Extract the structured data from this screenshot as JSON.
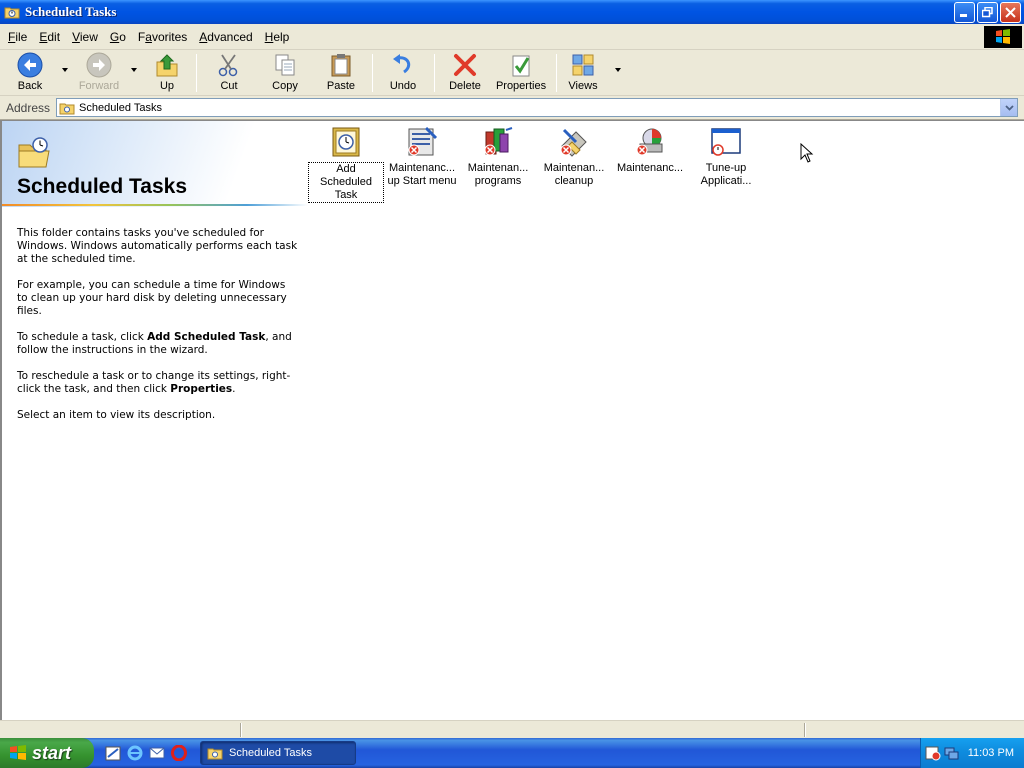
{
  "window": {
    "title": "Scheduled Tasks"
  },
  "menu": [
    {
      "ul": "F",
      "rest": "ile"
    },
    {
      "ul": "E",
      "rest": "dit"
    },
    {
      "ul": "V",
      "rest": "iew"
    },
    {
      "ul": "G",
      "rest": "o"
    },
    {
      "ul": "",
      "pre": "F",
      "mid": "a",
      "rest": "vorites"
    },
    {
      "ul": "A",
      "rest": "dvanced"
    },
    {
      "ul": "H",
      "rest": "elp"
    }
  ],
  "toolbar": {
    "back": "Back",
    "forward": "Forward",
    "up": "Up",
    "cut": "Cut",
    "copy": "Copy",
    "paste": "Paste",
    "undo": "Undo",
    "delete": "Delete",
    "properties": "Properties",
    "views": "Views"
  },
  "address": {
    "label": "Address",
    "value": "Scheduled Tasks"
  },
  "leftpane": {
    "title": "Scheduled Tasks",
    "p1": "This folder contains tasks you've scheduled for Windows. Windows automatically performs each task at the scheduled time.",
    "p2": "For example, you can schedule a time for Windows to clean up your hard disk by deleting unnecessary files.",
    "p3_pre": "To schedule a task, click ",
    "p3_bold": "Add Scheduled Task",
    "p3_post": ", and follow the instructions in the wizard.",
    "p4_pre": "To reschedule a task or to change its settings, right-click the task, and then click ",
    "p4_bold": "Properties",
    "p4_post": ".",
    "p5": "Select an item to view its description."
  },
  "items": [
    {
      "line1": "Add Scheduled",
      "line2": "Task",
      "icon": "add-task-icon"
    },
    {
      "line1": "Maintenanc...",
      "line2": "up Start menu",
      "icon": "maintenance-startmenu-icon"
    },
    {
      "line1": "Maintenan...",
      "line2": "programs",
      "icon": "maintenance-programs-icon"
    },
    {
      "line1": "Maintenan...",
      "line2": "cleanup",
      "icon": "maintenance-cleanup-icon"
    },
    {
      "line1": "Maintenanc...",
      "line2": "",
      "icon": "maintenance-disk-icon"
    },
    {
      "line1": "Tune-up",
      "line2": "Applicati...",
      "icon": "tune-up-icon"
    }
  ],
  "taskbar": {
    "start": "start",
    "task": "Scheduled Tasks",
    "clock": "11:03 PM"
  }
}
